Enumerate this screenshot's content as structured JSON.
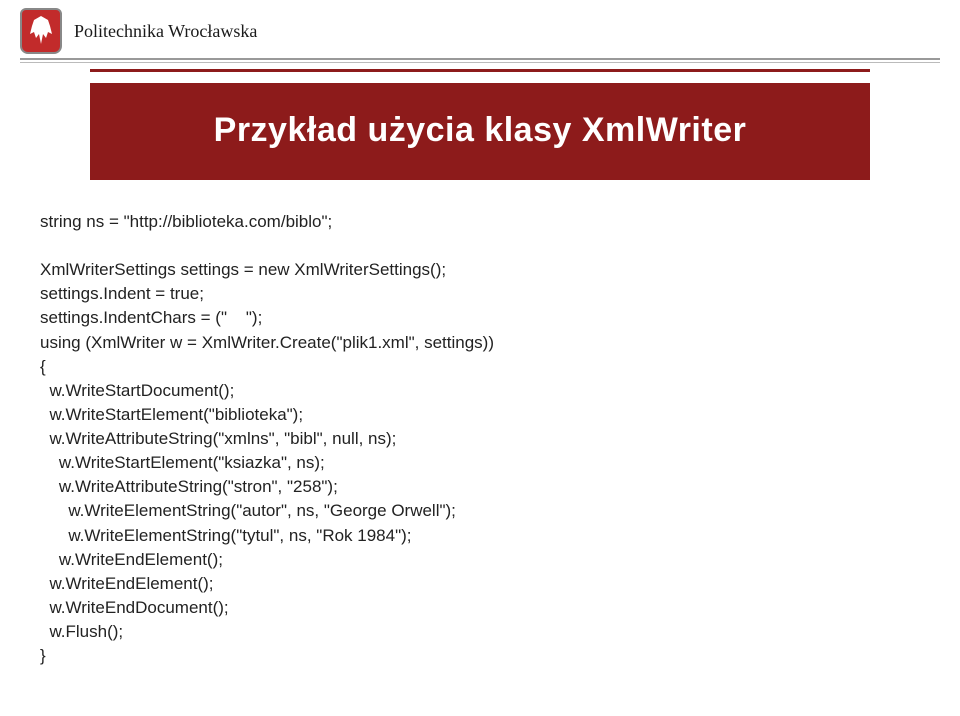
{
  "header": {
    "university": "Politechnika Wrocławska"
  },
  "title": "Przykład użycia klasy XmlWriter",
  "code": {
    "l1": "string ns = \"http://biblioteka.com/biblo\";",
    "l2": "XmlWriterSettings settings = new XmlWriterSettings();",
    "l3": "settings.Indent = true;",
    "l4": "settings.IndentChars = (\"    \");",
    "l5": "using (XmlWriter w = XmlWriter.Create(\"plik1.xml\", settings))",
    "l6": "{",
    "l7": "  w.WriteStartDocument();",
    "l8": "  w.WriteStartElement(\"biblioteka\");",
    "l9": "  w.WriteAttributeString(\"xmlns\", \"bibl\", null, ns);",
    "l10": "    w.WriteStartElement(\"ksiazka\", ns);",
    "l11": "    w.WriteAttributeString(\"stron\", \"258\");",
    "l12": "      w.WriteElementString(\"autor\", ns, \"George Orwell\");",
    "l13": "      w.WriteElementString(\"tytul\", ns, \"Rok 1984\");",
    "l14": "    w.WriteEndElement();",
    "l15": "  w.WriteEndElement();",
    "l16": "  w.WriteEndDocument();",
    "l17": "  w.Flush();",
    "l18": "}"
  }
}
